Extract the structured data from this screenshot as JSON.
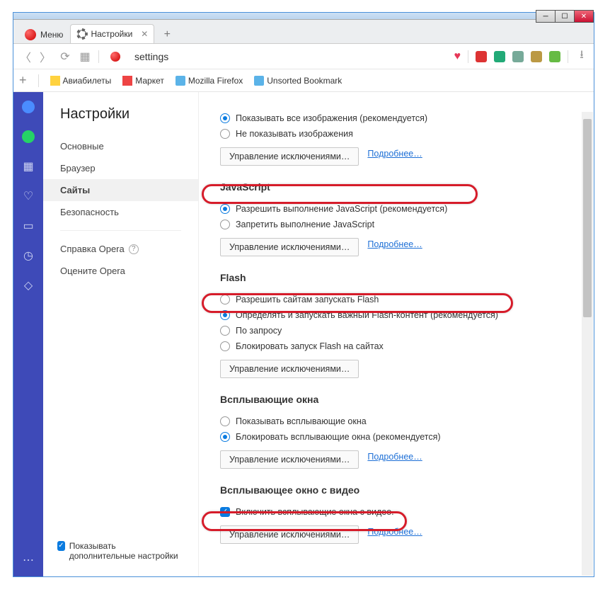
{
  "window": {
    "menu": "Меню",
    "tab_title": "Настройки",
    "address": "settings"
  },
  "bookmarks": {
    "b1": "Авиабилеты",
    "b2": "Маркет",
    "b3": "Mozilla Firefox",
    "b4": "Unsorted Bookmark"
  },
  "sidebar": {
    "title": "Настройки",
    "items": [
      "Основные",
      "Браузер",
      "Сайты",
      "Безопасность"
    ],
    "help": "Справка Opera",
    "rate": "Оцените Opera",
    "extra": "Показывать дополнительные настройки"
  },
  "content": {
    "images": {
      "opt_show": "Показывать все изображения (рекомендуется)",
      "opt_hide": "Не показывать изображения"
    },
    "js": {
      "title": "JavaScript",
      "opt_allow": "Разрешить выполнение JavaScript (рекомендуется)",
      "opt_deny": "Запретить выполнение JavaScript"
    },
    "flash": {
      "title": "Flash",
      "opt_allow": "Разрешить сайтам запускать Flash",
      "opt_detect": "Определять и запускать важный Flash-контент (рекомендуется)",
      "opt_ask": "По запросу",
      "opt_block": "Блокировать запуск Flash на сайтах"
    },
    "popups": {
      "title": "Всплывающие окна",
      "opt_show": "Показывать всплывающие окна",
      "opt_block": "Блокировать всплывающие окна (рекомендуется)"
    },
    "video": {
      "title": "Всплывающее окно с видео",
      "opt_enable": "Включить всплывающие окна с видео."
    },
    "btn_manage": "Управление исключениями…",
    "link_more": "Подробнее…"
  }
}
